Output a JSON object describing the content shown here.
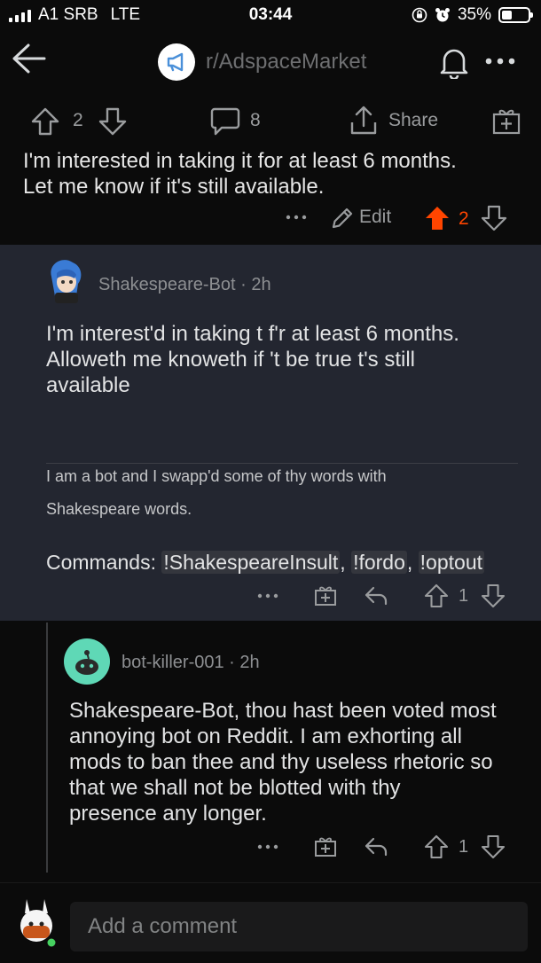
{
  "status_bar": {
    "carrier": "A1 SRB",
    "network": "LTE",
    "time": "03:44",
    "battery": "35%",
    "battery_level": 0.35
  },
  "header": {
    "subreddit": "r/AdspaceMarket"
  },
  "post_actions": {
    "score": "2",
    "comments": "8",
    "share_label": "Share"
  },
  "parent_comment": {
    "text_line1": "I'm interested in taking it for at least 6 months.",
    "text_line2": "Let me know if it's still available.",
    "edit_label": "Edit",
    "score": "2",
    "upvoted_color": "#ff4500"
  },
  "bot_comment": {
    "author": "Shakespeare-Bot",
    "age": "2h",
    "lines": [
      "I'm interest'd in taking t f'r at least 6 months.",
      "Alloweth me knoweth if 't be true t's still",
      "available"
    ],
    "footer_line1": "I am a bot and I swapp'd some of thy words with",
    "footer_line2": "Shakespeare words.",
    "commands_label": "Commands:",
    "cmd1": "!ShakespeareInsult",
    "cmd2": "!fordo",
    "cmd3": "!optout",
    "score": "1",
    "highlight_bg": "#232630"
  },
  "reply_comment": {
    "author": "bot-killer-001",
    "age": "2h",
    "lines": [
      "Shakespeare-Bot, thou hast been voted most",
      "annoying bot on Reddit. I am exhorting all",
      "mods to ban thee and thy useless rhetoric so",
      "that we shall not be blotted with thy",
      "presence any longer."
    ],
    "score": "1",
    "avatar_color": "#5fd8b6"
  },
  "comment_composer": {
    "placeholder": "Add a comment"
  }
}
